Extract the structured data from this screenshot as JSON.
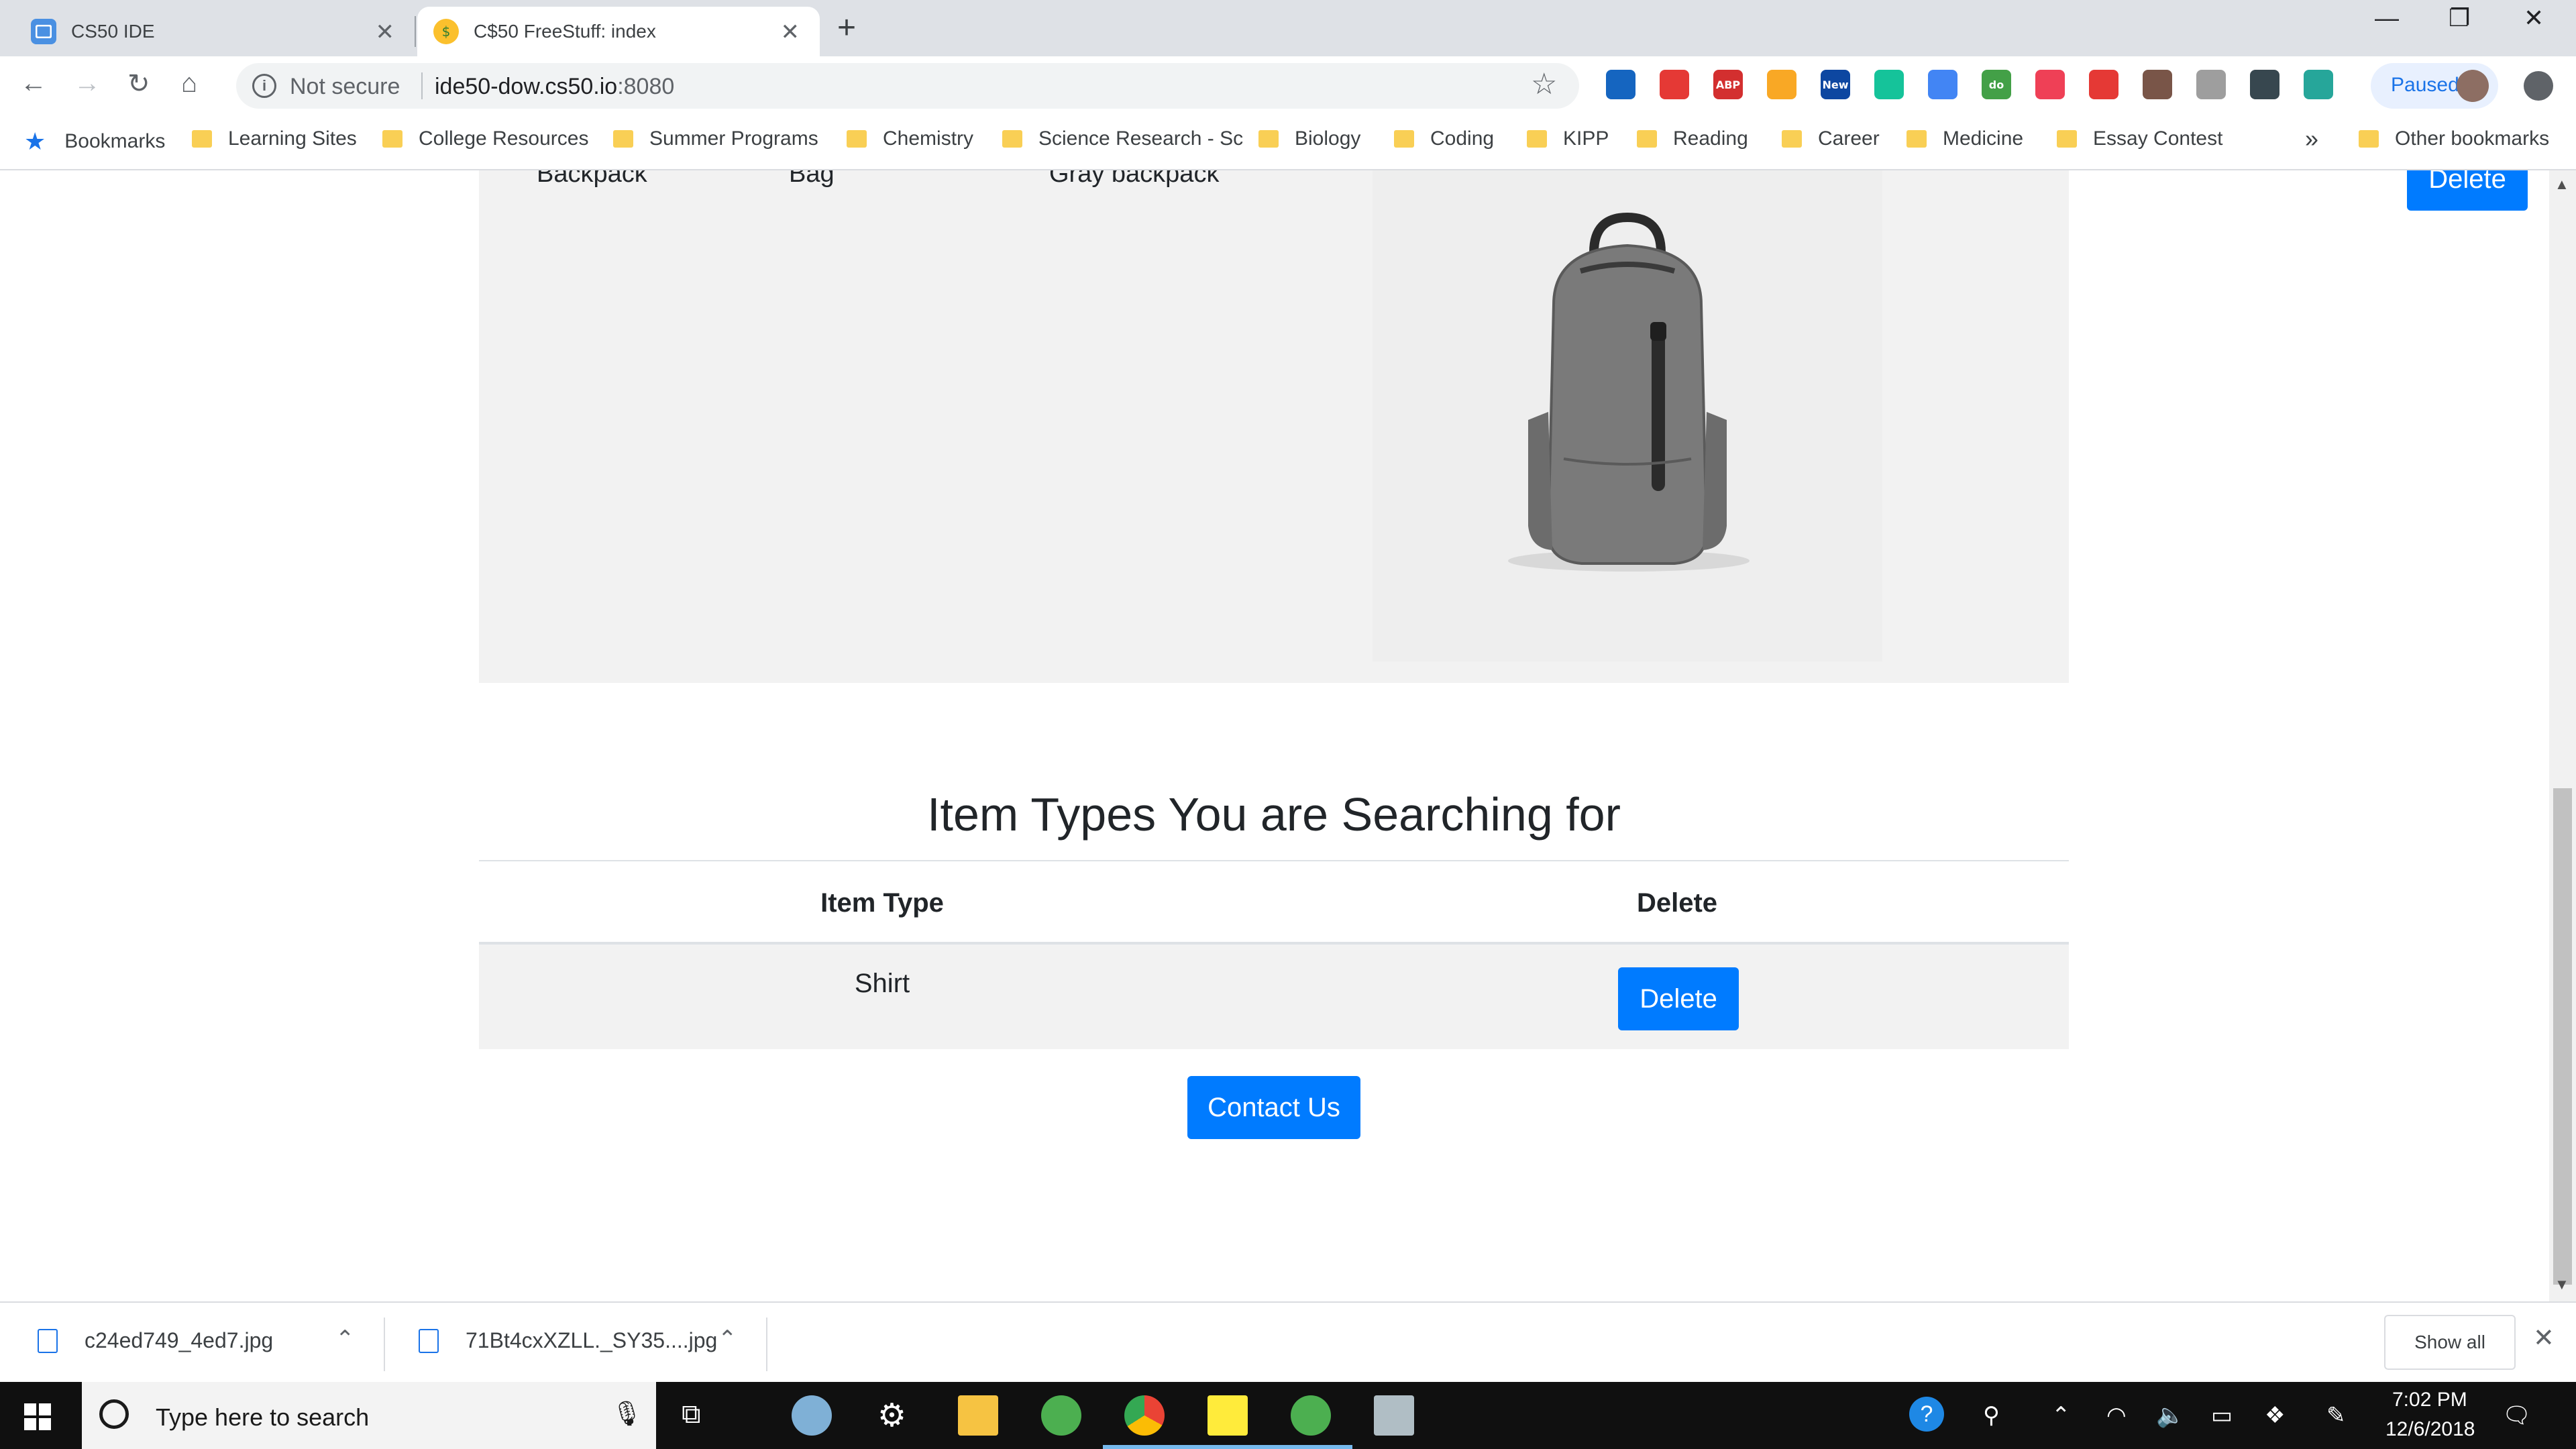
{
  "browser": {
    "tabs": [
      {
        "title": "CS50 IDE"
      },
      {
        "title": "C$50 FreeStuff: index"
      }
    ],
    "omnibox": {
      "security_label": "Not secure",
      "url_host": "ide50-dow.cs50.io",
      "url_port": ":8080"
    },
    "extensions": [
      {
        "icon": "library-icon",
        "color": "#1565c0"
      },
      {
        "icon": "opera-icon",
        "color": "#e53935"
      },
      {
        "icon": "adblock-plus-icon",
        "color": "#d32f2f",
        "text": "ABP"
      },
      {
        "icon": "compass-icon",
        "color": "#f9a825"
      },
      {
        "icon": "new-badge-extension-icon",
        "color": "#0d47a1",
        "text": "New"
      },
      {
        "icon": "grammarly-icon",
        "color": "#15c39a"
      },
      {
        "icon": "google-drive-icon",
        "color": "#4285f4"
      },
      {
        "icon": "do-icon",
        "color": "#43a047",
        "text": "do"
      },
      {
        "icon": "pocket-icon",
        "color": "#ef4056"
      },
      {
        "icon": "pdf-icon",
        "color": "#e53935"
      },
      {
        "icon": "paint-icon",
        "color": "#795548"
      },
      {
        "icon": "f-extension-icon",
        "color": "#9e9e9e"
      },
      {
        "icon": "dots-extension-icon",
        "color": "#37474f"
      },
      {
        "icon": "mercury-icon",
        "color": "#26a69a"
      }
    ],
    "profile": {
      "status": "Paused"
    },
    "bookmarks_label": "Bookmarks",
    "bookmarks": [
      "Learning Sites",
      "College Resources",
      "Summer Programs",
      "Chemistry",
      "Science Research - Sc",
      "Biology",
      "Coding",
      "KIPP",
      "Reading",
      "Career",
      "Medicine",
      "Essay Contest"
    ],
    "bookmarks_overflow": "»",
    "other_bookmarks": "Other bookmarks"
  },
  "page": {
    "item": {
      "name": "Backpack",
      "category": "Bag",
      "description": "Gray backpack",
      "delete_label": "Delete"
    },
    "types_section": {
      "heading": "Item Types You are Searching for",
      "columns": [
        "Item Type",
        "Delete"
      ],
      "rows": [
        {
          "type": "Shirt",
          "delete_label": "Delete"
        }
      ]
    },
    "contact_label": "Contact Us"
  },
  "downloads": {
    "files": [
      "c24ed749_4ed7.jpg",
      "71Bt4cxXZLL._SY35....jpg"
    ],
    "show_all": "Show all"
  },
  "taskbar": {
    "search_placeholder": "Type here to search",
    "time": "7:02 PM",
    "date": "12/6/2018"
  },
  "colors": {
    "primary_button": "#007bff",
    "card_background": "#f2f2f2",
    "taskbar": "#101010"
  }
}
